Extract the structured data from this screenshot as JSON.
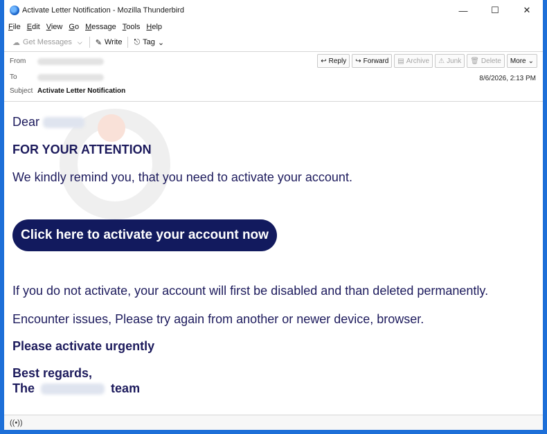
{
  "window": {
    "title": "Activate Letter Notification - Mozilla Thunderbird"
  },
  "menu": [
    {
      "label": "File",
      "key": "F",
      "rest": "ile"
    },
    {
      "label": "Edit",
      "key": "E",
      "rest": "dit"
    },
    {
      "label": "View",
      "key": "V",
      "rest": "iew"
    },
    {
      "label": "Go",
      "key": "G",
      "rest": "o"
    },
    {
      "label": "Message",
      "key": "M",
      "rest": "essage"
    },
    {
      "label": "Tools",
      "key": "T",
      "rest": "ools"
    },
    {
      "label": "Help",
      "key": "H",
      "rest": "elp"
    }
  ],
  "toolbar": {
    "get_messages": "Get Messages",
    "write": "Write",
    "tag": "Tag"
  },
  "header": {
    "from_label": "From",
    "to_label": "To",
    "subject_label": "Subject",
    "subject": "Activate Letter Notification",
    "date": "8/6/2026, 2:13 PM",
    "buttons": {
      "reply": "Reply",
      "forward": "Forward",
      "archive": "Archive",
      "junk": "Junk",
      "delete": "Delete",
      "more": "More"
    }
  },
  "body": {
    "greeting": "Dear",
    "attention": "FOR YOUR ATTENTION",
    "remind": "We kindly remind you, that you need to activate your account.",
    "cta": "Click here to activate your account now",
    "warning": "If you do not activate, your account will first be disabled and than deleted permanently.",
    "issues": "Encounter issues, Please try again from another or newer device, browser.",
    "urgent": "Please activate urgently",
    "regards": "Best regards,",
    "team_prefix": "The",
    "team_suffix": "team"
  },
  "icons": {
    "app": "thunderbird-icon",
    "minimize": "minimize-icon",
    "maximize": "maximize-icon",
    "close": "close-icon",
    "get_messages": "cloud-download-icon",
    "write": "pencil-icon",
    "tag": "tag-icon",
    "reply": "reply-icon",
    "forward": "forward-icon",
    "archive": "archive-icon",
    "junk": "junk-icon",
    "delete": "trash-icon",
    "status": "wireless-status-icon"
  },
  "colors": {
    "accent": "#1d6fd8",
    "text": "#1c1a5c",
    "button": "#121a5e"
  }
}
